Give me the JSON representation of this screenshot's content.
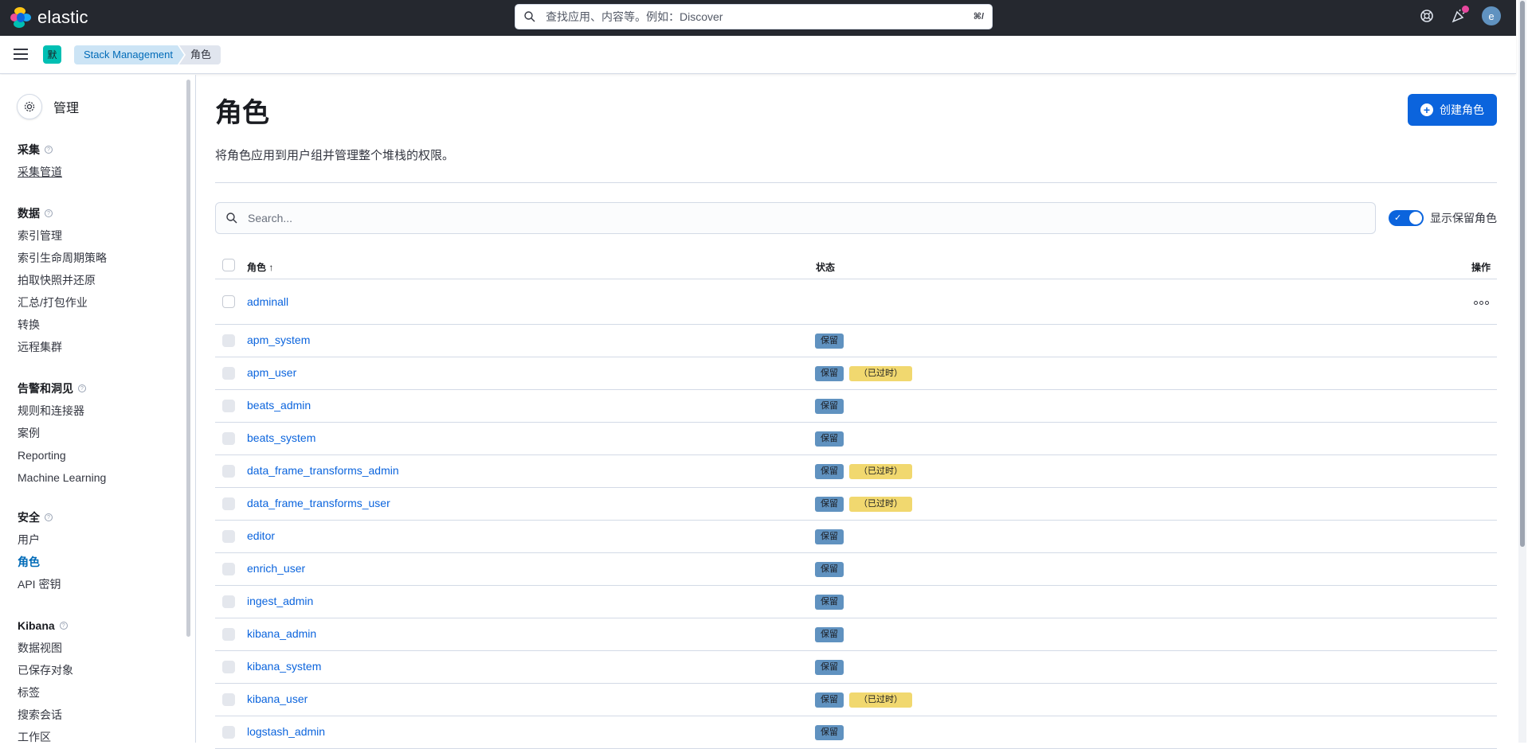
{
  "header": {
    "brand": "elastic",
    "search_placeholder": "查找应用、内容等。例如：Discover",
    "search_shortcut": "⌘/",
    "avatar_initial": "e"
  },
  "breadcrumb": {
    "space_initial": "默",
    "items": [
      "Stack Management",
      "角色"
    ]
  },
  "sidebar": {
    "title": "管理",
    "groups": [
      {
        "title": "采集",
        "items": [
          "采集管道"
        ]
      },
      {
        "title": "数据",
        "items": [
          "索引管理",
          "索引生命周期策略",
          "拍取快照并还原",
          "汇总/打包作业",
          "转换",
          "远程集群"
        ]
      },
      {
        "title": "告警和洞见",
        "items": [
          "规则和连接器",
          "案例",
          "Reporting",
          "Machine Learning"
        ]
      },
      {
        "title": "安全",
        "items": [
          "用户",
          "角色",
          "API 密钥"
        ]
      },
      {
        "title": "Kibana",
        "items": [
          "数据视图",
          "已保存对象",
          "标签",
          "搜索会话",
          "工作区"
        ]
      }
    ]
  },
  "main": {
    "title": "角色",
    "create_button": "创建角色",
    "description": "将角色应用到用户组并管理整个堆栈的权限。",
    "search_placeholder": "Search...",
    "toggle_label": "显示保留角色",
    "columns": {
      "role": "角色 ↑",
      "status": "状态",
      "actions": "操作"
    },
    "badge_reserved": "保留",
    "badge_deprecated": "（已过时）",
    "rows": [
      {
        "name": "adminall",
        "reserved": false,
        "deprecated": false
      },
      {
        "name": "apm_system",
        "reserved": true,
        "deprecated": false
      },
      {
        "name": "apm_user",
        "reserved": true,
        "deprecated": true
      },
      {
        "name": "beats_admin",
        "reserved": true,
        "deprecated": false
      },
      {
        "name": "beats_system",
        "reserved": true,
        "deprecated": false
      },
      {
        "name": "data_frame_transforms_admin",
        "reserved": true,
        "deprecated": true
      },
      {
        "name": "data_frame_transforms_user",
        "reserved": true,
        "deprecated": true
      },
      {
        "name": "editor",
        "reserved": true,
        "deprecated": false
      },
      {
        "name": "enrich_user",
        "reserved": true,
        "deprecated": false
      },
      {
        "name": "ingest_admin",
        "reserved": true,
        "deprecated": false
      },
      {
        "name": "kibana_admin",
        "reserved": true,
        "deprecated": false
      },
      {
        "name": "kibana_system",
        "reserved": true,
        "deprecated": false
      },
      {
        "name": "kibana_user",
        "reserved": true,
        "deprecated": true
      },
      {
        "name": "logstash_admin",
        "reserved": true,
        "deprecated": false
      }
    ]
  }
}
